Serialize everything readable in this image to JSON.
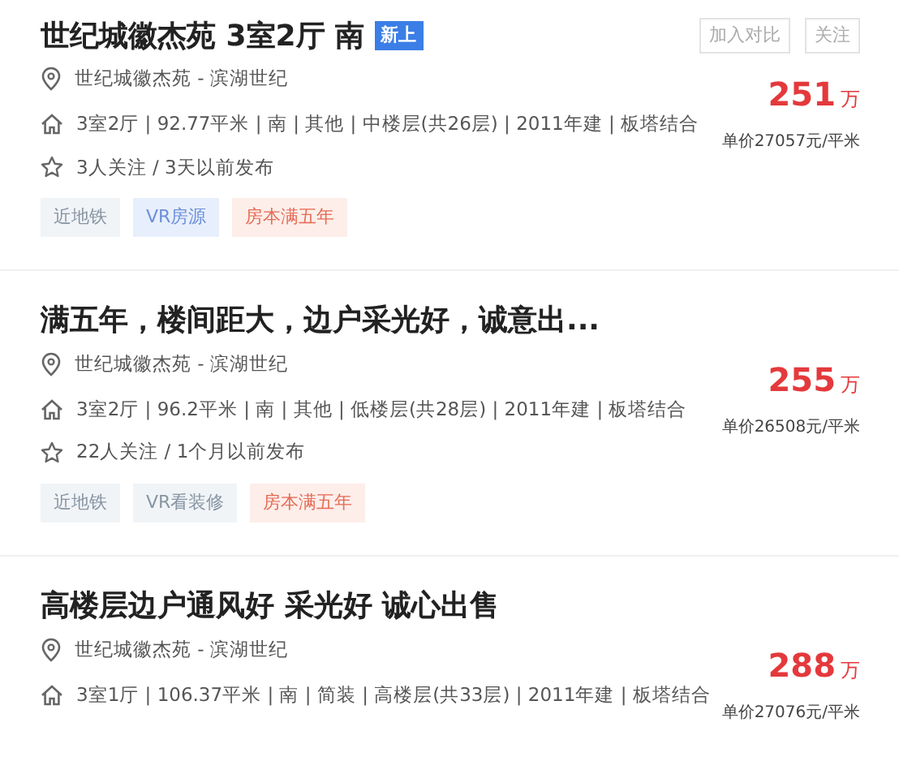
{
  "listings": [
    {
      "title": "世纪城徽杰苑 3室2厅 南",
      "badge": "新上",
      "actions": [
        "加入对比",
        "关注"
      ],
      "location": "世纪城徽杰苑 - 滨湖世纪",
      "info": "3室2厅 | 92.77平米 | 南 | 其他 | 中楼层(共26层) | 2011年建 | 板塔结合",
      "follow": "3人关注 / 3天以前发布",
      "price": "251",
      "price_unit": "万",
      "unit_price": "单价27057元/平米",
      "tags": [
        {
          "label": "近地铁",
          "kind": "plain"
        },
        {
          "label": "VR房源",
          "kind": "vr"
        },
        {
          "label": "房本满五年",
          "kind": "tax"
        }
      ]
    },
    {
      "title": "满五年，楼间距大，边户采光好，诚意出...",
      "location": "世纪城徽杰苑 - 滨湖世纪",
      "info": "3室2厅 | 96.2平米 | 南 | 其他 | 低楼层(共28层) | 2011年建 | 板塔结合",
      "follow": "22人关注 / 1个月以前发布",
      "price": "255",
      "price_unit": "万",
      "unit_price": "单价26508元/平米",
      "tags": [
        {
          "label": "近地铁",
          "kind": "plain"
        },
        {
          "label": "VR看装修",
          "kind": "plain"
        },
        {
          "label": "房本满五年",
          "kind": "tax"
        }
      ]
    },
    {
      "title": "高楼层边户通风好 采光好 诚心出售",
      "location": "世纪城徽杰苑 - 滨湖世纪",
      "info": "3室1厅 | 106.37平米 | 南 | 简装 | 高楼层(共33层) | 2011年建 | 板塔结合",
      "price": "288",
      "price_unit": "万",
      "unit_price": "单价27076元/平米"
    }
  ]
}
